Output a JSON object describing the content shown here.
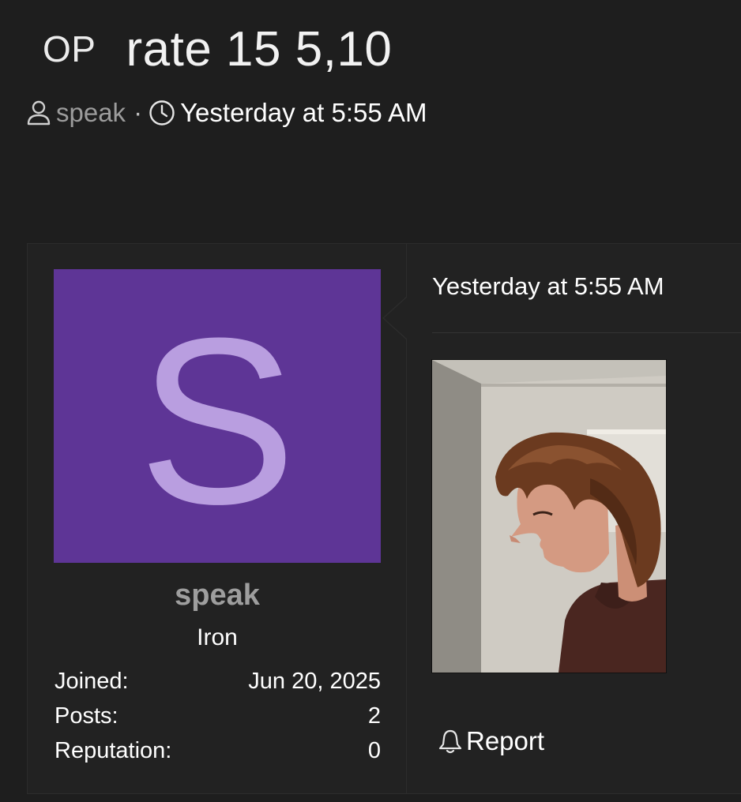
{
  "thread": {
    "prefix": "OP",
    "title": "rate 15 5,10",
    "author": "speak",
    "separator": "·",
    "date": "Yesterday at 5:55 AM"
  },
  "post": {
    "avatar_letter": "S",
    "username": "speak",
    "user_title": "Iron",
    "stats": [
      {
        "label": "Joined:",
        "value": "Jun 20, 2025"
      },
      {
        "label": "Posts:",
        "value": "2"
      },
      {
        "label": "Reputation:",
        "value": "0"
      }
    ],
    "date": "Yesterday at 5:55 AM",
    "report_label": "Report"
  },
  "icons": {
    "author": "user-icon",
    "date": "clock-icon",
    "report": "bell-icon"
  },
  "colors": {
    "background": "#1e1e1e",
    "post_background": "#222222",
    "avatar_bg": "#5e3596",
    "avatar_letter": "#b99ee0",
    "username": "#9e9e9e"
  }
}
